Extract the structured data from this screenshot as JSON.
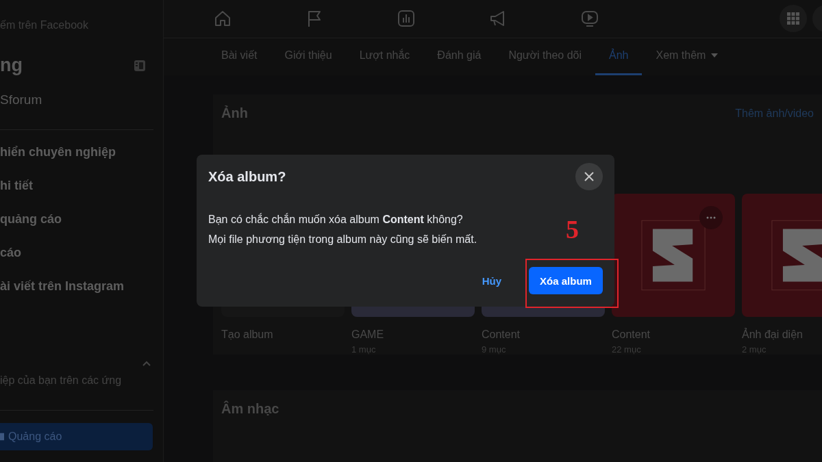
{
  "top_bar": {
    "search_placeholder": "ếm trên Facebook"
  },
  "sidebar": {
    "title": "ng",
    "page_name": "Sforum",
    "items": [
      {
        "label": "hiển chuyên nghiệp"
      },
      {
        "label": "hi tiết"
      },
      {
        "label": "quảng cáo"
      },
      {
        "label": "cáo"
      },
      {
        "label": "ài viết trên Instagram"
      }
    ],
    "section_text": "iệp của bạn trên các ứng",
    "ad_button": "Quảng cáo"
  },
  "tabs": [
    {
      "label": "Bài viết",
      "selected": false,
      "kind": "plain"
    },
    {
      "label": "Giới thiệu",
      "selected": false,
      "kind": "plain"
    },
    {
      "label": "Lượt nhắc",
      "selected": false,
      "kind": "plain"
    },
    {
      "label": "Đánh giá",
      "selected": false,
      "kind": "plain"
    },
    {
      "label": "Người theo dõi",
      "selected": false,
      "kind": "plain"
    },
    {
      "label": "Ảnh",
      "selected": true,
      "kind": "plain"
    },
    {
      "label": "Xem thêm",
      "selected": false,
      "kind": "dropdown"
    }
  ],
  "photos_section": {
    "title": "Ảnh",
    "action": "Thêm ảnh/video",
    "albums": [
      {
        "kind": "create",
        "name": "Tạo album"
      },
      {
        "kind": "photo",
        "name": "GAME",
        "count": "1 mục"
      },
      {
        "kind": "photo",
        "name": "Content",
        "count": "9 mục"
      },
      {
        "kind": "logo",
        "name": "Content",
        "count": "22 mục"
      },
      {
        "kind": "logo",
        "name": "Ảnh đại diện",
        "count": "2 mục"
      }
    ]
  },
  "music_section": {
    "title": "Âm nhạc"
  },
  "dialog": {
    "title": "Xóa album?",
    "message": "Bạn có chắc chắn muốn xóa album **Content** không?",
    "message_2": "Mọi file phương tiện trong album này cũng sẽ biến mất.",
    "cancel": "Hủy",
    "confirm": "Xóa album"
  },
  "annotation": {
    "step": "5"
  }
}
